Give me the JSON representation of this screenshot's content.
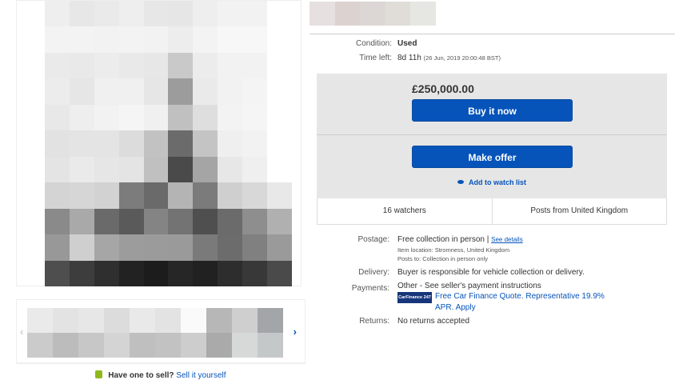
{
  "listing": {
    "condition_label": "Condition:",
    "condition": "Used",
    "time_left_label": "Time left:",
    "time_left": "8d 11h",
    "end_date": "(26 Jun, 2019   20:00:48 BST)",
    "price": "£250,000.00",
    "buy_now": "Buy it now",
    "make_offer": "Make offer",
    "watch_list": "Add to watch list",
    "watchers": "16 watchers",
    "posts_from": "Posts from United Kingdom"
  },
  "details": {
    "postage_label": "Postage:",
    "postage": "Free collection in person",
    "postage_sep": "|",
    "see_details": "See details",
    "item_location": "Item location:   Stromness, United Kingdom",
    "posts_to": "Posts to:   Collection in person only",
    "delivery_label": "Delivery:",
    "delivery": "Buyer is responsible for vehicle collection or delivery.",
    "payments_label": "Payments:",
    "payments": "Other - See seller's payment instructions",
    "finance_logo": "CarFinance 247",
    "finance_line1": "Free Car Finance Quote. Representative 19.9%",
    "finance_line2": "APR. Apply",
    "returns_label": "Returns:",
    "returns": "No returns accepted"
  },
  "sell": {
    "question": "Have one to sell?",
    "link": "Sell it yourself"
  },
  "icons": {
    "left_arrow": "‹",
    "right_arrow": "›"
  }
}
